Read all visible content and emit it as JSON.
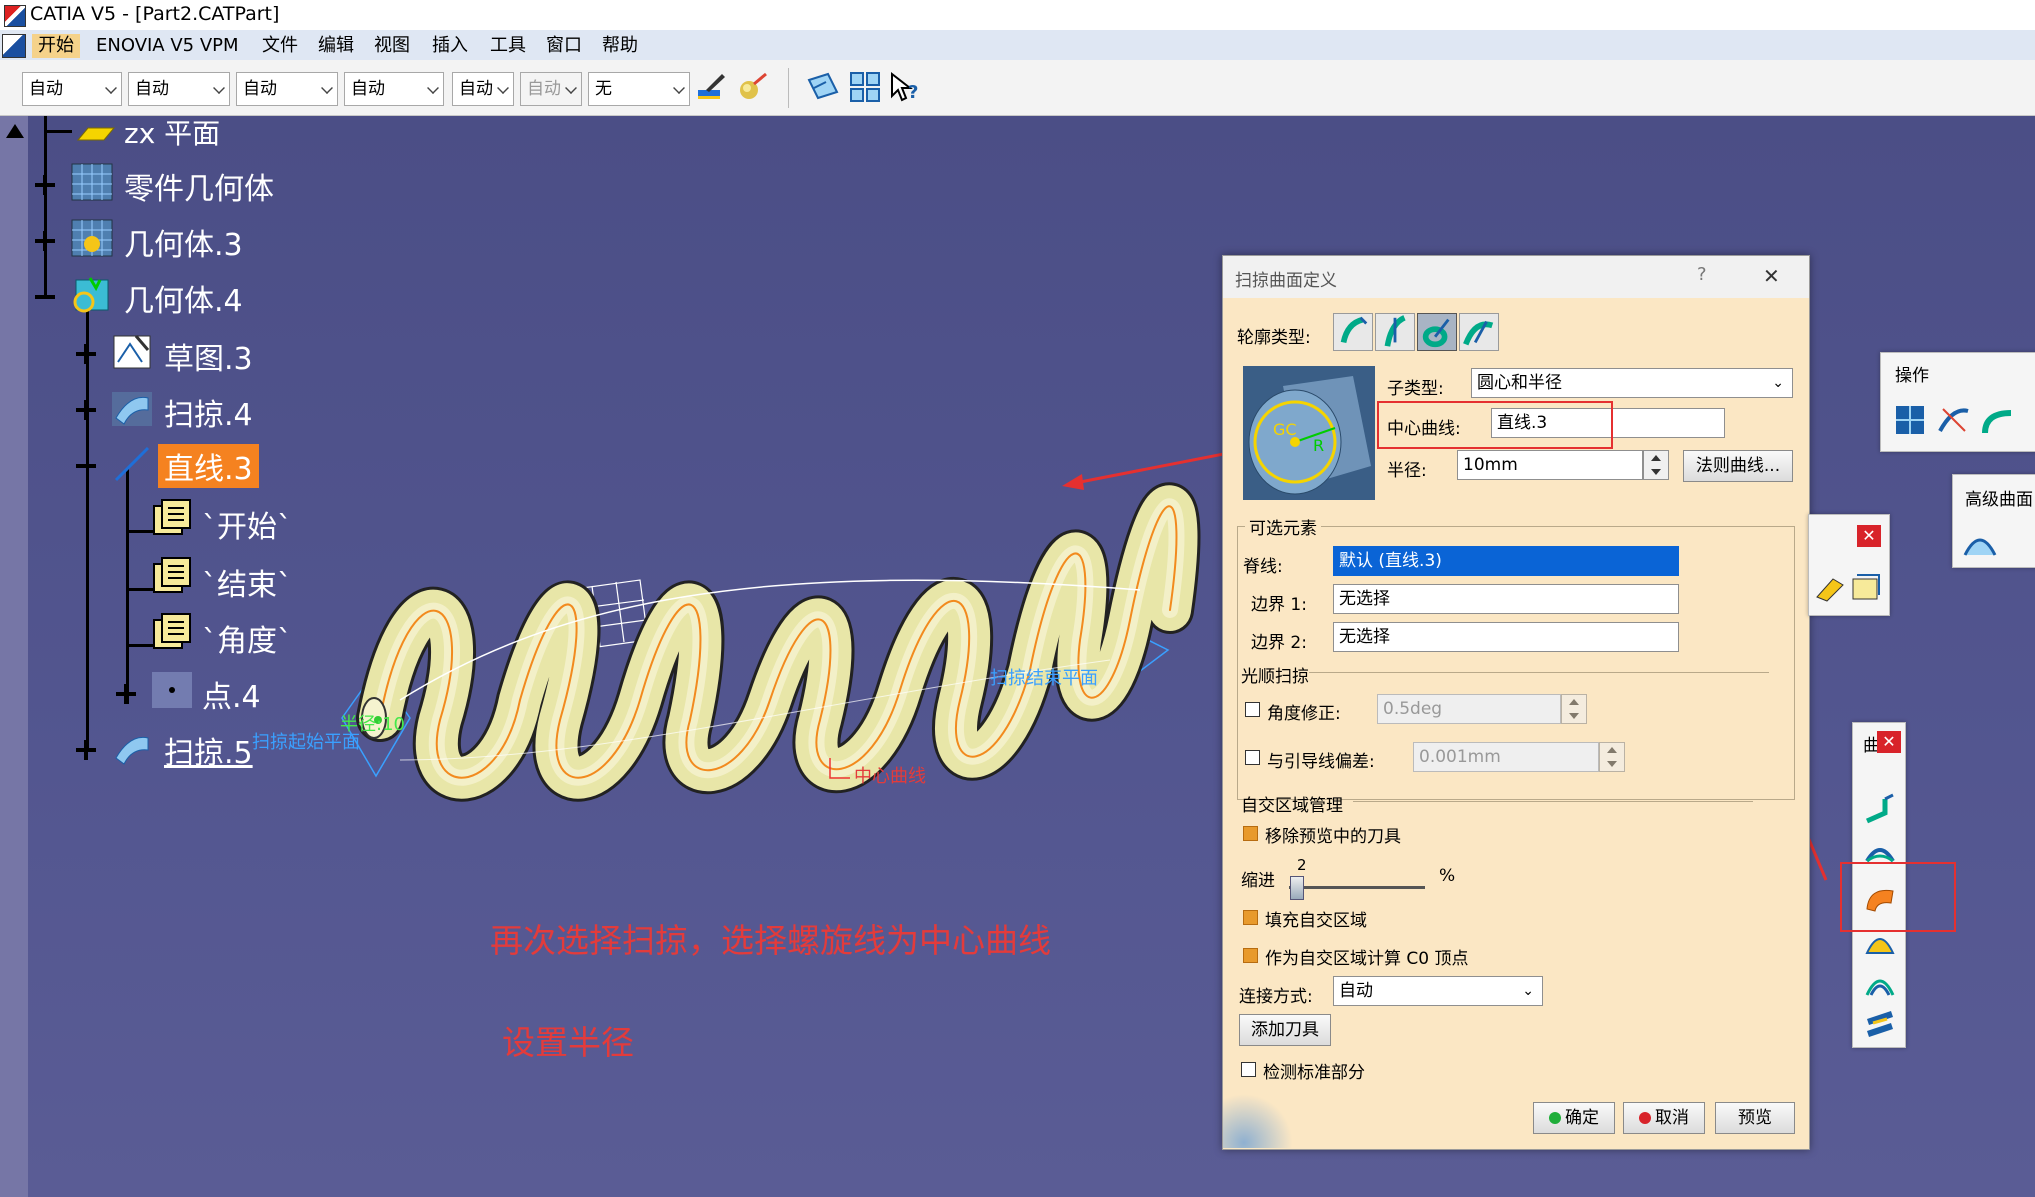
{
  "window": {
    "title": "CATIA V5 - [Part2.CATPart]"
  },
  "menu": [
    "开始",
    "ENOVIA V5 VPM",
    "文件",
    "编辑",
    "视图",
    "插入",
    "工具",
    "窗口",
    "帮助"
  ],
  "toolbar": {
    "combos": [
      "自动",
      "自动",
      "自动",
      "自动",
      "自动",
      "自动",
      "无"
    ]
  },
  "tree": {
    "items": [
      {
        "label": "zx 平面"
      },
      {
        "label": "零件几何体"
      },
      {
        "label": "几何体.3"
      },
      {
        "label": "几何体.4"
      },
      {
        "label": "草图.3"
      },
      {
        "label": "扫掠.4"
      },
      {
        "label": "直线.3"
      },
      {
        "label": "`开始`"
      },
      {
        "label": "`结束`"
      },
      {
        "label": "`角度`"
      },
      {
        "label": "点.4"
      },
      {
        "label": "扫掠.5"
      }
    ]
  },
  "viewport": {
    "labels": {
      "start": "扫掠起始平面",
      "end": "扫掠结束平面",
      "center": "中心曲线",
      "radius": "半径:10"
    }
  },
  "annotations": {
    "line1": "再次选择扫掠，选择螺旋线为中心曲线",
    "line2": "设置半径"
  },
  "dialog": {
    "title": "扫掠曲面定义",
    "help": "?",
    "close": "✕",
    "profile_type_label": "轮廓类型:",
    "subtype_label": "子类型:",
    "subtype_value": "圆心和半径",
    "center_curve_label": "中心曲线:",
    "center_curve_value": "直线.3",
    "radius_label": "半径:",
    "radius_value": "10mm",
    "law_button": "法则曲线...",
    "optional_group": "可选元素",
    "spine_label": "脊线:",
    "spine_value": "默认 (直线.3)",
    "boundary1_label": "边界 1:",
    "boundary1_value": "无选择",
    "boundary2_label": "边界 2:",
    "boundary2_value": "无选择",
    "smooth_group": "光顺扫掠",
    "angle_fix_label": "角度修正:",
    "angle_fix_value": "0.5deg",
    "deviation_label": "与引导线偏差:",
    "deviation_value": "0.001mm",
    "self_intersect_group": "自交区域管理",
    "remove_preview_label": "移除预览中的刀具",
    "indent_label": "缩进",
    "indent_value": "2",
    "indent_unit": "%",
    "indent_level": 0.02,
    "fill_label": "填充自交区域",
    "c0_label": "作为自交区域计算 C0 顶点",
    "connect_label": "连接方式:",
    "connect_value": "自动",
    "add_tool_button": "添加刀具",
    "detect_label": "检测标准部分",
    "ok_button": "确定",
    "cancel_button": "取消",
    "preview_button": "预览",
    "preview_img": {
      "gc": "GC",
      "r": "R"
    }
  },
  "palettes": {
    "ops_title": "操作",
    "adv_title": "高级曲面",
    "small_title": "曲",
    "close": "✕"
  },
  "colors": {
    "accent_orange": "#f58220",
    "select_blue": "#0a64d6",
    "annotation_red": "#e33b3b",
    "dialog_bg": "#fbe7c4"
  }
}
